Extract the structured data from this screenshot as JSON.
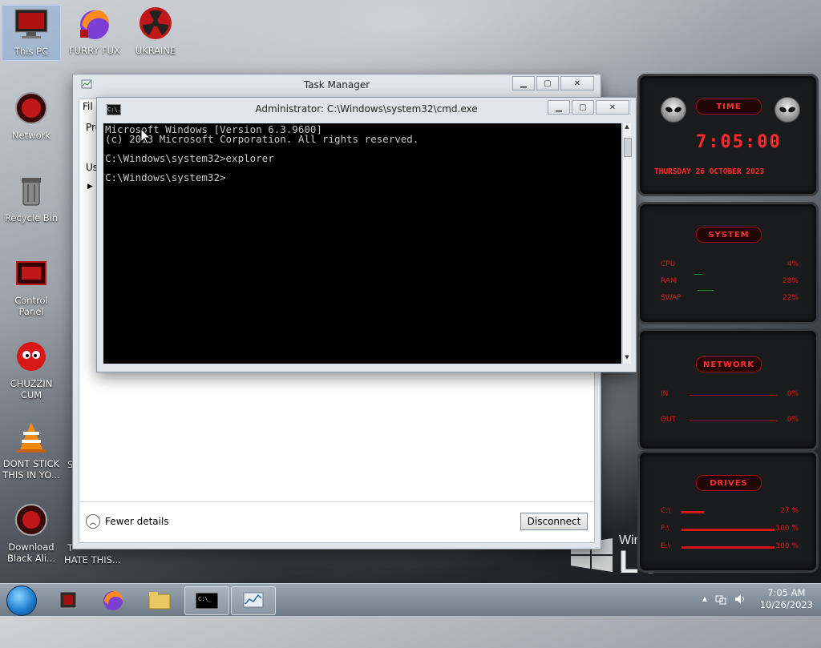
{
  "desktop": {
    "icons": [
      {
        "label": "This PC"
      },
      {
        "label": "FURRY FUX"
      },
      {
        "label": "UKRAINE"
      },
      {
        "label": "Network"
      },
      {
        "label": "Recycle Bin"
      },
      {
        "label": "Control Panel"
      },
      {
        "label": "CHUZZIN CUM"
      },
      {
        "label": "DONT STICK THIS IN YO..."
      },
      {
        "label": "Download Black Ali..."
      },
      {
        "label": "HATE THIS..."
      }
    ],
    "partial_left_labels": [
      "S",
      "T"
    ],
    "logo_text": "LO",
    "logo_small": "Win"
  },
  "task_manager": {
    "title": "Task Manager",
    "menu_partial": "Fil",
    "tab_partial": "Pro",
    "user_partial": "Use",
    "fewer_details": "Fewer details",
    "disconnect": "Disconnect"
  },
  "cmd": {
    "title": "Administrator: C:\\Windows\\system32\\cmd.exe",
    "icon_text": "C:\\.",
    "lines": [
      "Microsoft Windows [Version 6.3.9600]",
      "(c) 2013 Microsoft Corporation. All rights reserved.",
      "",
      "C:\\Windows\\system32>explorer",
      "",
      "C:\\Windows\\system32>"
    ]
  },
  "gadgets": {
    "time": {
      "title": "TIME",
      "clock": "7:05:00",
      "date": "THURSDAY 26 OCTOBER 2023"
    },
    "system": {
      "title": "SYSTEM",
      "rows": [
        {
          "label": "CPU",
          "value": "4%"
        },
        {
          "label": "RAM",
          "value": "28%"
        },
        {
          "label": "SWAP",
          "value": "22%"
        }
      ]
    },
    "network": {
      "title": "NETWORK",
      "rows": [
        {
          "label": "IN",
          "value": "0%"
        },
        {
          "label": "OUT",
          "value": "0%"
        }
      ]
    },
    "drives": {
      "title": "DRIVES",
      "rows": [
        {
          "label": "C:\\",
          "value": "27 %"
        },
        {
          "label": "F:\\",
          "value": "100 %"
        },
        {
          "label": "E:\\",
          "value": "100 %"
        }
      ]
    }
  },
  "taskbar": {
    "time": "7:05 AM",
    "date": "10/26/2023",
    "tray_expand": "▲"
  },
  "colors": {
    "accent_red": "#ff2a2a",
    "console_bg": "#000000",
    "console_fg": "#c8c8c8"
  }
}
